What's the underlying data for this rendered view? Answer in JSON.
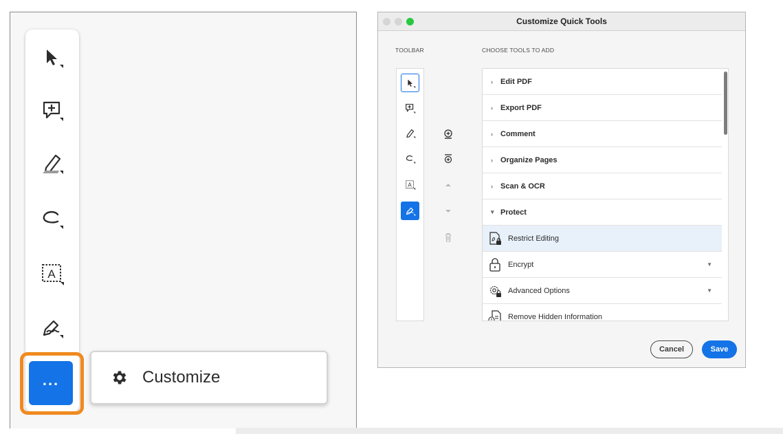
{
  "left": {
    "toolbar_tools": [
      {
        "icon": "select-arrow-icon"
      },
      {
        "icon": "add-comment-icon"
      },
      {
        "icon": "highlight-pen-icon"
      },
      {
        "icon": "lasso-draw-icon"
      },
      {
        "icon": "text-box-icon"
      },
      {
        "icon": "fill-sign-icon"
      }
    ],
    "more_button": {
      "label": "...",
      "icon": "more-icon"
    },
    "customize_popup": {
      "label": "Customize",
      "icon": "gear-icon"
    }
  },
  "dialog": {
    "title": "Customize Quick Tools",
    "toolbar_label": "TOOLBAR",
    "choose_label": "CHOOSE TOOLS TO ADD",
    "categories": [
      {
        "label": "Edit PDF",
        "expanded": false
      },
      {
        "label": "Export PDF",
        "expanded": false
      },
      {
        "label": "Comment",
        "expanded": false
      },
      {
        "label": "Organize Pages",
        "expanded": false
      },
      {
        "label": "Scan & OCR",
        "expanded": false
      },
      {
        "label": "Protect",
        "expanded": true
      }
    ],
    "protect_tools": [
      {
        "label": "Restrict Editing",
        "icon": "restrict-editing-icon",
        "highlighted": true,
        "has_dropdown": false
      },
      {
        "label": "Encrypt",
        "icon": "lock-icon",
        "highlighted": false,
        "has_dropdown": true
      },
      {
        "label": "Advanced Options",
        "icon": "advanced-options-icon",
        "highlighted": false,
        "has_dropdown": true
      },
      {
        "label": "Remove Hidden Information",
        "icon": "remove-hidden-info-icon",
        "highlighted": false,
        "has_dropdown": false
      }
    ],
    "cancel_label": "Cancel",
    "save_label": "Save"
  },
  "colors": {
    "accent": "#1473e6",
    "highlight_border": "#f08a1f",
    "traffic_close": "#d5d5d5",
    "traffic_min": "#d5d5d5",
    "traffic_max": "#28c840"
  }
}
